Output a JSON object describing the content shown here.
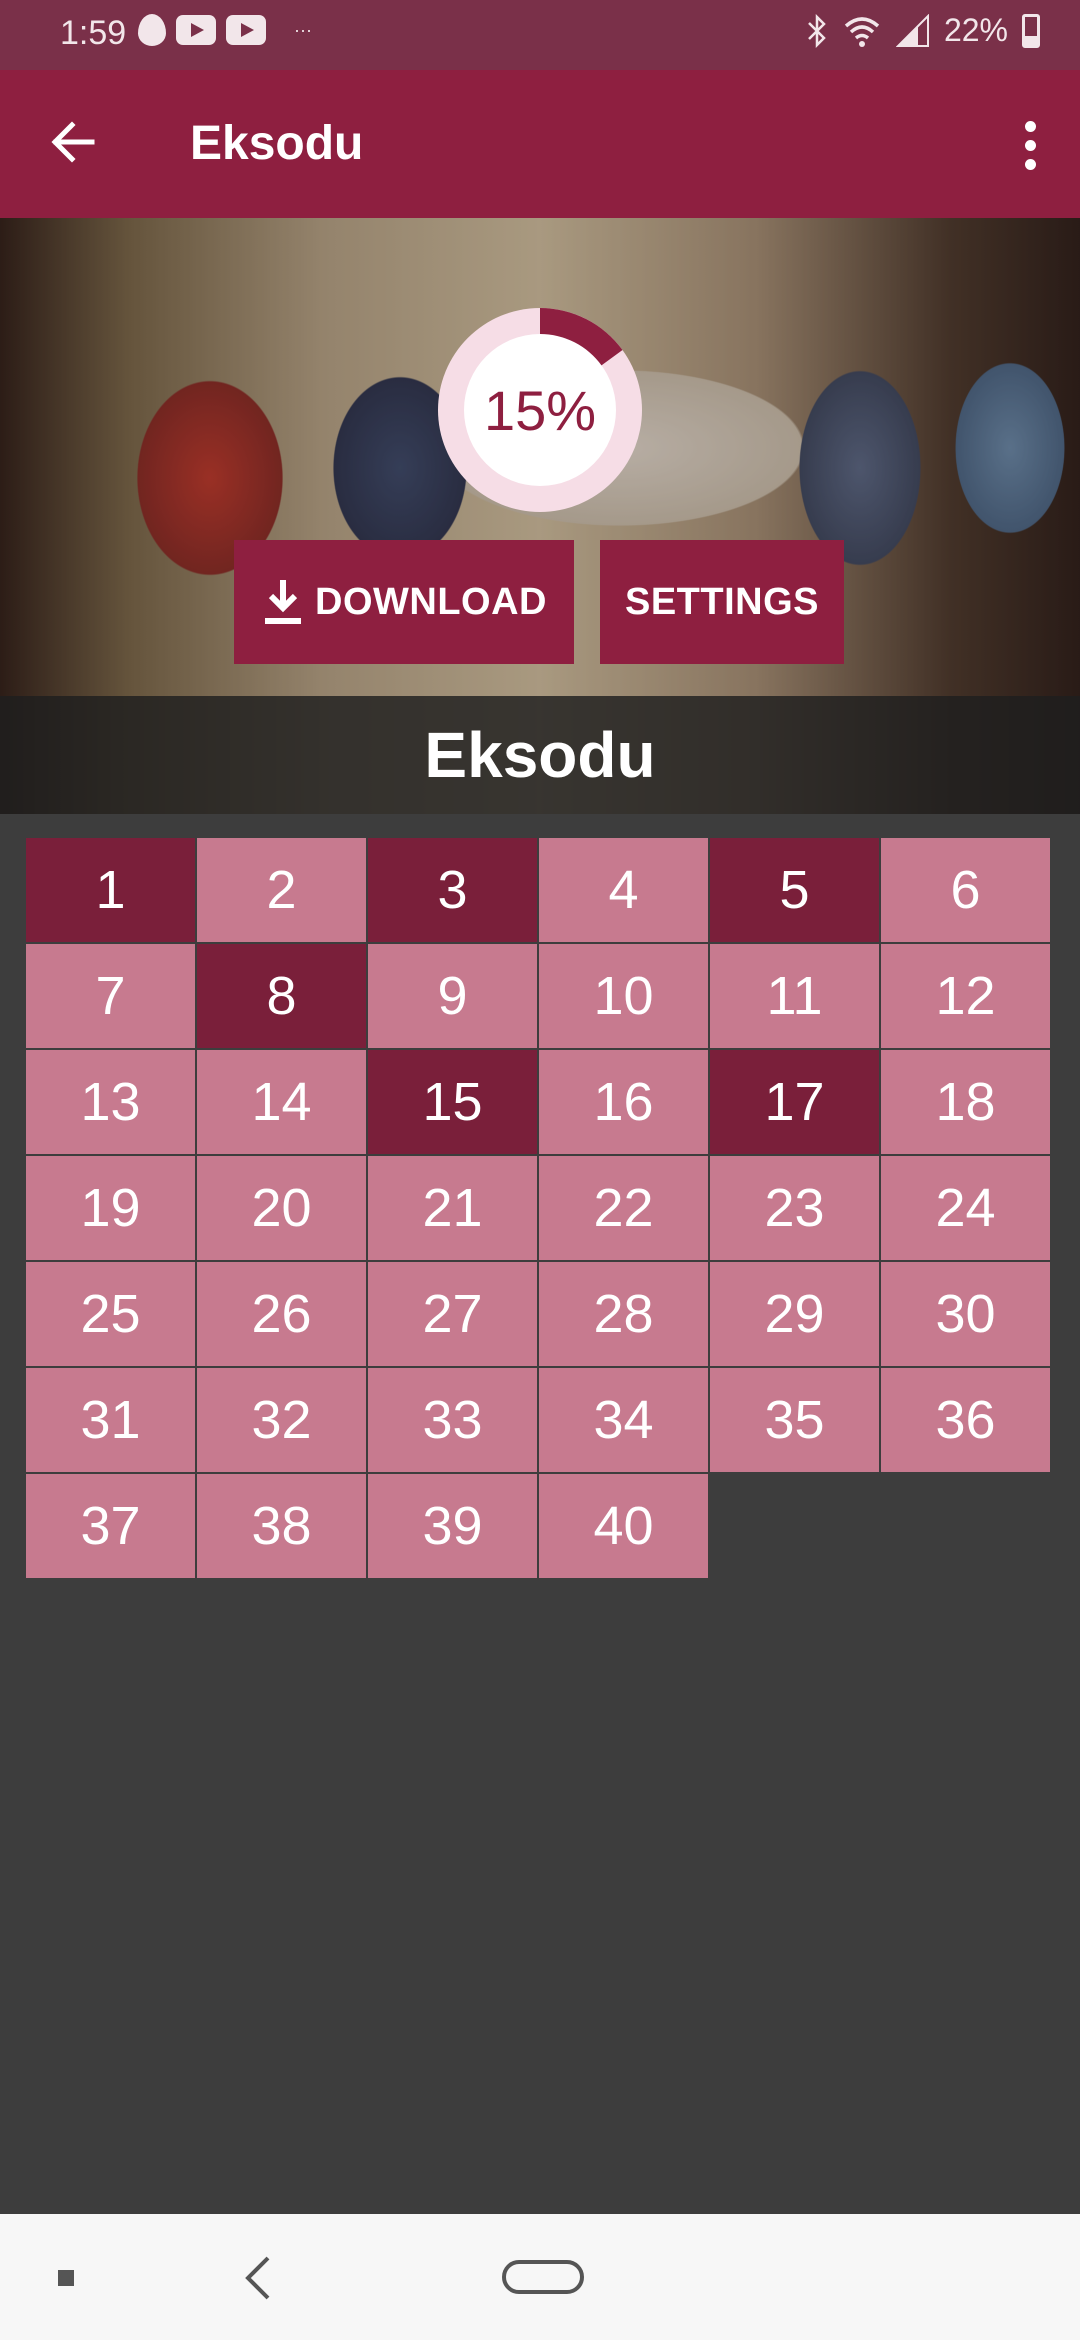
{
  "status_bar": {
    "time": "1:59",
    "battery": "22%",
    "icons": [
      "flame-icon",
      "youtube-icon",
      "youtube-icon",
      "more-notifications-icon",
      "bluetooth-icon",
      "wifi-icon",
      "signal-icon",
      "battery-icon"
    ],
    "overflow": "···"
  },
  "app_bar": {
    "title": "Eksodu",
    "color": "#8e1f40"
  },
  "hero": {
    "progress_label": "15%",
    "progress": 0.15,
    "download_label": "DOWNLOAD",
    "settings_label": "SETTINGS",
    "book_title": "Eksodu"
  },
  "chapters": {
    "items": [
      "1",
      "2",
      "3",
      "4",
      "5",
      "6",
      "7",
      "8",
      "9",
      "10",
      "11",
      "12",
      "13",
      "14",
      "15",
      "16",
      "17",
      "18",
      "19",
      "20",
      "21",
      "22",
      "23",
      "24",
      "25",
      "26",
      "27",
      "28",
      "29",
      "30",
      "31",
      "32",
      "33",
      "34",
      "35",
      "36",
      "37",
      "38",
      "39",
      "40"
    ],
    "read": [
      "1",
      "3",
      "5",
      "8",
      "15",
      "17"
    ],
    "read_color": "#7a1f3a",
    "unread_color": "#c77a8f"
  }
}
